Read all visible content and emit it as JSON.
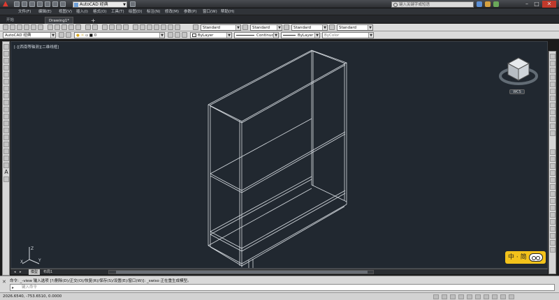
{
  "titlebar": {
    "workspace": "AutoCAD 经典",
    "title": "",
    "search_placeholder": "键入关键字或短语"
  },
  "menu": [
    "文件(F)",
    "编辑(E)",
    "视图(V)",
    "插入(I)",
    "格式(O)",
    "工具(T)",
    "绘图(D)",
    "标注(N)",
    "修改(M)",
    "参数(P)",
    "窗口(W)",
    "帮助(H)"
  ],
  "tabs": {
    "start": "开始",
    "drawing": "Drawing1*"
  },
  "toolbar1": {
    "text_style": "Standard",
    "dim_style": "Standard",
    "table_style": "Standard",
    "mleader_style": "Standard"
  },
  "toolbar2": {
    "workspace": "AutoCAD 经典",
    "layer": "0",
    "color": "ByLayer",
    "linetype": "Continuous",
    "lineweight": "ByLayer",
    "plotstyle": "ByColor"
  },
  "viewport": {
    "label": "[-][西南等轴测][二维线框]",
    "wcs": "WCS",
    "ime": "中 · 简"
  },
  "layout_tabs": {
    "model": "模型",
    "layout1": "布局1"
  },
  "command": {
    "history": "命令: _-view 输入选项 [?/删除(D)/正交(O)/恢复(R)/保存(S)/设置(E)/窗口(W)]: _swiso 正在重生成模型。",
    "placeholder": "键入命令"
  },
  "status": {
    "coords": "2026.6540, -753.6510, 0.0000"
  },
  "colors": {
    "viewport_bg": "#212830",
    "wire": "#d8dde2",
    "accent": "#e03a2f"
  }
}
